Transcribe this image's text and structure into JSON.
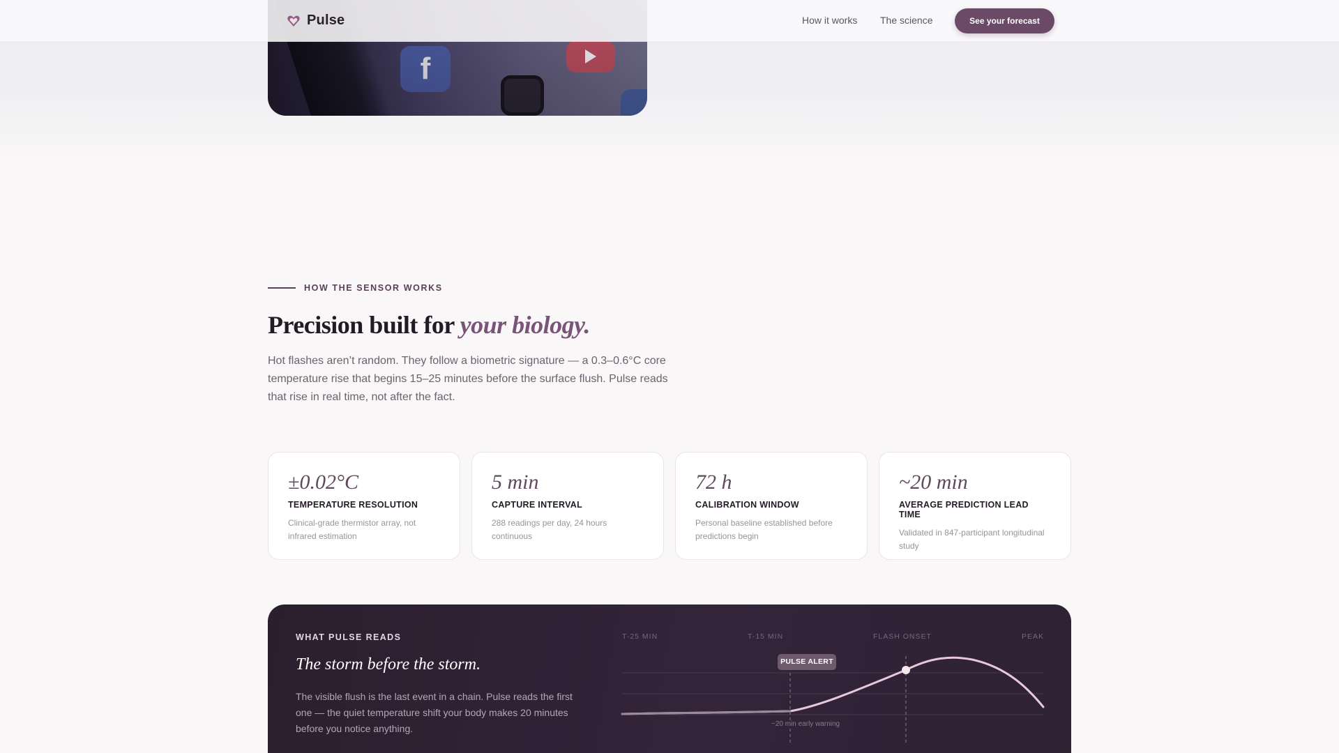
{
  "brand": {
    "name": "Pulse",
    "icon": "heart-icon",
    "accent": "#6a4a66"
  },
  "nav": {
    "links": [
      "How it works",
      "The science"
    ],
    "cta": "See your forecast"
  },
  "hero_image": {
    "icons": [
      "facebook-app-icon",
      "youtube-app-icon",
      "wallet-app-icon",
      "app-icon"
    ]
  },
  "section": {
    "eyebrow": "HOW THE SENSOR WORKS",
    "headline_plain": "Precision built for ",
    "headline_accent": "your biology.",
    "lede": "Hot flashes aren’t random. They follow a biometric signature — a 0.3–0.6°C core temperature rise that begins 15–25 minutes before the surface flush. Pulse reads that rise in real time, not after the fact."
  },
  "stats": [
    {
      "value": "±0.02°C",
      "label": "TEMPERATURE RESOLUTION",
      "desc": "Clinical-grade thermistor array, not infrared estimation"
    },
    {
      "value": "5 min",
      "label": "CAPTURE INTERVAL",
      "desc": "288 readings per day, 24 hours continuous"
    },
    {
      "value": "72 h",
      "label": "CALIBRATION WINDOW",
      "desc": "Personal baseline established before predictions begin"
    },
    {
      "value": "~20 min",
      "label": "AVERAGE PREDICTION LEAD TIME",
      "desc": "Validated in 847-participant longitudinal study"
    }
  ],
  "panel": {
    "eyebrow": "WHAT PULSE READS",
    "title": "The storm before the storm.",
    "text": "The visible flush is the last event in a chain. Pulse reads the first one — the quiet temperature shift your body makes 20 minutes before you notice anything.",
    "timeline": [
      "T-25 MIN",
      "T-15 MIN",
      "FLASH ONSET",
      "PEAK"
    ],
    "alert": "PULSE ALERT",
    "note": "~20 min early warning"
  },
  "chart_data": {
    "type": "line",
    "x": [
      "T-25 MIN",
      "T-15 MIN",
      "FLASH ONSET",
      "PEAK"
    ],
    "series": [
      {
        "values": [
          0,
          0.05,
          0.55,
          0.9
        ]
      }
    ]
  }
}
